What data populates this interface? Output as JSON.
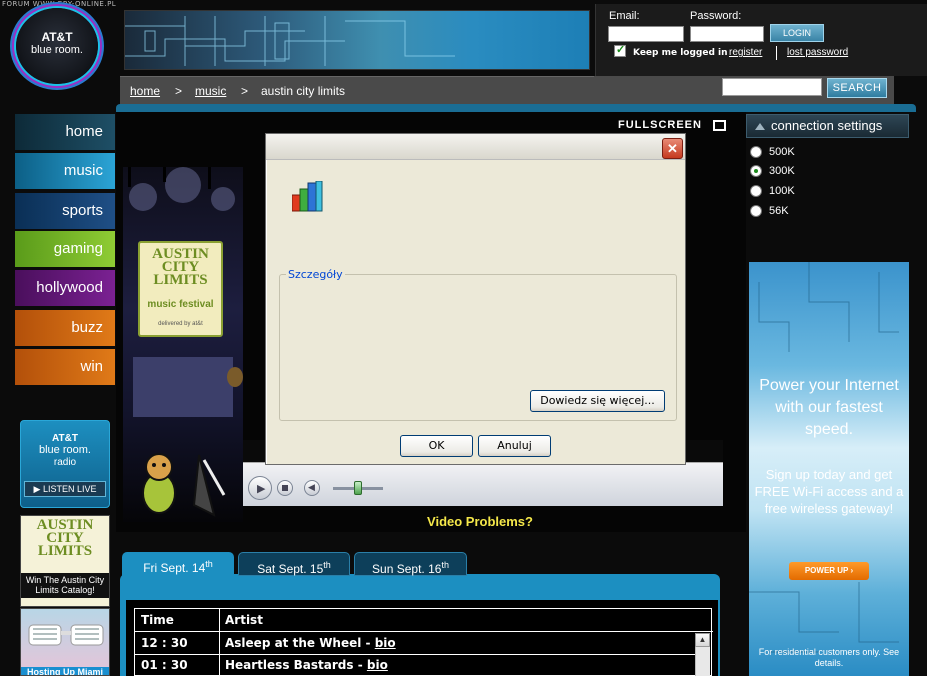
{
  "forum_stamp": "FORUM WWW.GRY-ONLINE.PL",
  "logo": {
    "line1": "AT&T",
    "line2": "blue room."
  },
  "login": {
    "email_label": "Email:",
    "password_label": "Password:",
    "login_button": "LOGIN",
    "keep_logged_in": "Keep me logged in",
    "register": "register",
    "lost_password": "lost password"
  },
  "breadcrumb": {
    "items": [
      "home",
      "music",
      "austin city limits"
    ],
    "separator": ">"
  },
  "search": {
    "button": "SEARCH"
  },
  "nav": {
    "home": "home",
    "music": "music",
    "sports": "sports",
    "gaming": "gaming",
    "hollywood": "hollywood",
    "buzz": "buzz",
    "win": "win"
  },
  "radio_promo": {
    "line1": "AT&T",
    "line2": "blue room.",
    "line3": "radio",
    "button": "LISTEN LIVE"
  },
  "acl_promo": {
    "logo": "AUSTIN CITY LIMITS",
    "caption": "Win The Austin City Limits Catalog!"
  },
  "glasses_promo": {
    "caption": "Hosting Up Miami"
  },
  "player": {
    "fullscreen": "FULLSCREEN",
    "sign_title": "AUSTIN CITY LIMITS",
    "sign_sub": "music festival",
    "sign_footer": "delivered by at&t",
    "video_problems": "Video Problems?"
  },
  "days": [
    {
      "label": "Fri Sept. 14",
      "sup": "th"
    },
    {
      "label": "Sat Sept. 15",
      "sup": "th"
    },
    {
      "label": "Sun Sept. 16",
      "sup": "th"
    }
  ],
  "schedule": {
    "headers": [
      "Time",
      "Artist"
    ],
    "rows": [
      {
        "time": "12 : 30",
        "artist": "Asleep at the Wheel",
        "link": "bio"
      },
      {
        "time": "01 : 30",
        "artist": "Heartless Bastards",
        "link": "bio"
      }
    ]
  },
  "connection": {
    "header": "connection settings",
    "options": [
      "500K",
      "300K",
      "100K",
      "56K"
    ],
    "selected": "300K"
  },
  "ad": {
    "headline": "Power your Internet with our fastest speed.",
    "body": "Sign up today and get FREE Wi-Fi access and a free wireless gateway!",
    "button": "POWER UP",
    "fine": "For residential customers only. See details."
  },
  "dialog": {
    "close": "✕",
    "details_label": "Szczegóły",
    "learn_more": "Dowiedz się więcej...",
    "ok": "OK",
    "cancel": "Anuluj"
  },
  "colors": {
    "accent": "#1c8fc1",
    "video_problems": "#f5e84a",
    "dialog_bg": "#ece9d8"
  }
}
